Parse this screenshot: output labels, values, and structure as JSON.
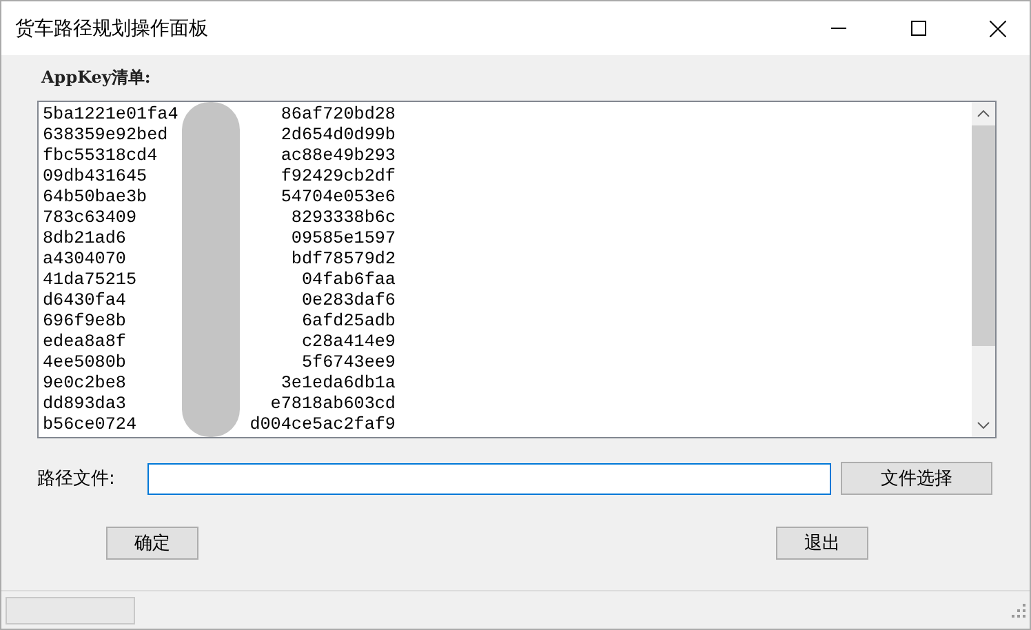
{
  "window": {
    "title": "货车路径规划操作面板"
  },
  "appkey_list": {
    "label": "AppKey清单:",
    "rows": [
      {
        "left": "5ba1221e01fa4",
        "right": "86af720bd28"
      },
      {
        "left": "638359e92bed",
        "right": "2d654d0d99b"
      },
      {
        "left": "fbc55318cd4",
        "right": "ac88e49b293"
      },
      {
        "left": "09db431645",
        "right": "f92429cb2df"
      },
      {
        "left": "64b50bae3b",
        "right": "54704e053e6"
      },
      {
        "left": "783c63409",
        "right": "8293338b6c"
      },
      {
        "left": "8db21ad6",
        "right": "09585e1597"
      },
      {
        "left": "a4304070",
        "right": "bdf78579d2"
      },
      {
        "left": "41da75215",
        "right": "04fab6faa"
      },
      {
        "left": "d6430fa4",
        "right": "0e283daf6"
      },
      {
        "left": "696f9e8b",
        "right": "6afd25adb"
      },
      {
        "left": "edea8a8f",
        "right": "c28a414e9"
      },
      {
        "left": "4ee5080b",
        "right": "5f6743ee9"
      },
      {
        "left": "9e0c2be8",
        "right": "3e1eda6db1a"
      },
      {
        "left": "dd893da3",
        "right": "e7818ab603cd"
      },
      {
        "left": "b56ce0724",
        "right": "d004ce5ac2faf9"
      }
    ]
  },
  "path_field": {
    "label": "路径文件:"
  },
  "file_button": "文件选择",
  "buttons": {
    "ok": "确定",
    "exit": "退出"
  }
}
